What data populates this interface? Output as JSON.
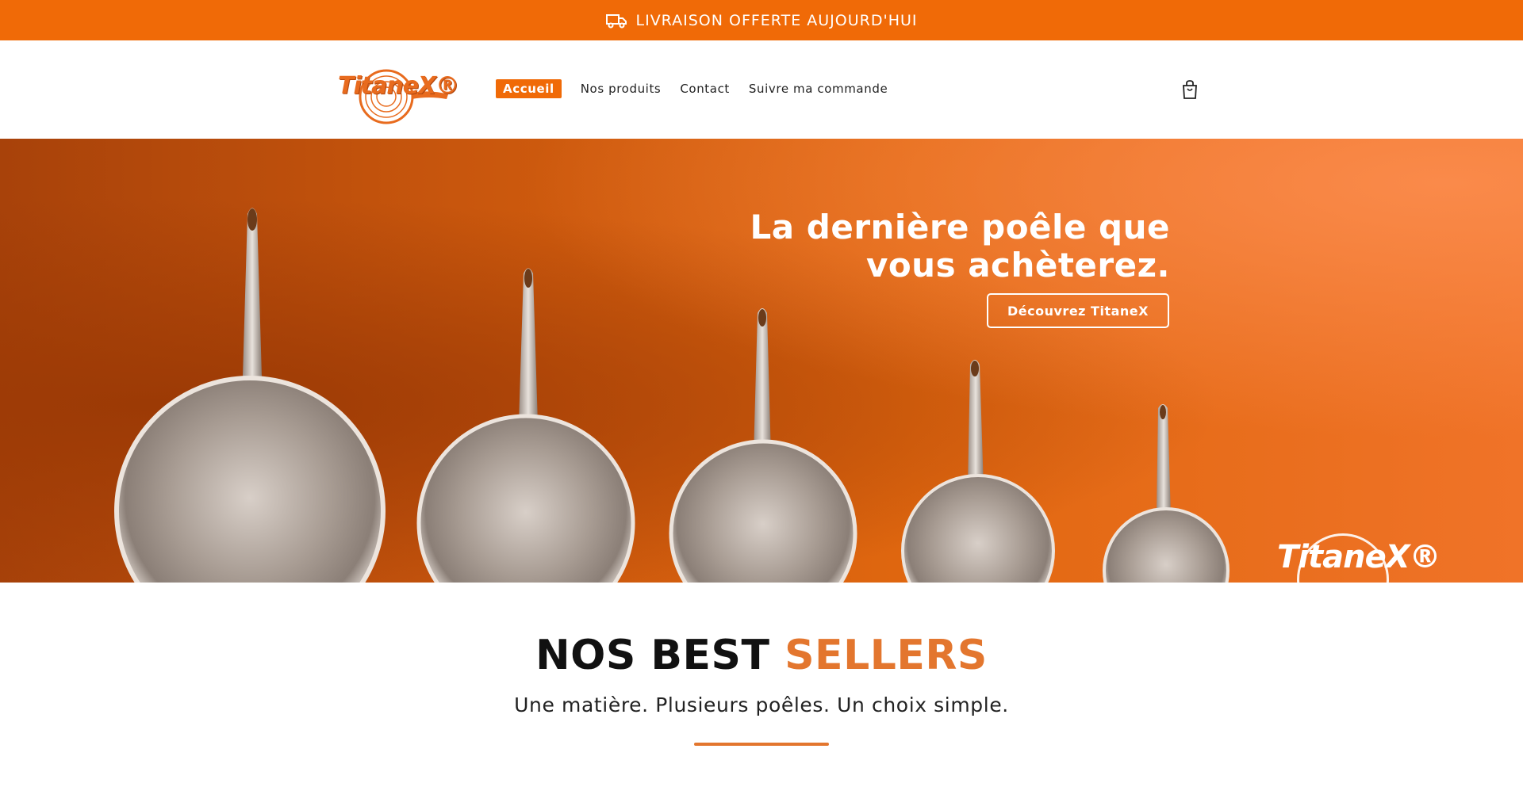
{
  "announcement": {
    "text": "LIVRAISON OFFERTE AUJOURD'HUI",
    "icon": "truck-icon"
  },
  "brand": {
    "logo_text": "TitaneX®",
    "accent": "#f06a07"
  },
  "nav": {
    "items": [
      {
        "label": "Accueil",
        "active": true
      },
      {
        "label": "Nos produits",
        "active": false
      },
      {
        "label": "Contact",
        "active": false
      },
      {
        "label": "Suivre ma commande",
        "active": false
      }
    ]
  },
  "header": {
    "cart_icon": "shopping-bag-icon"
  },
  "hero": {
    "title_line1": "La dernière poêle que",
    "title_line2": "vous achèterez.",
    "cta_label": "Découvrez TitaneX",
    "watermark": "TitaneX®"
  },
  "best_sellers": {
    "title_part1": "NOS BEST",
    "title_part2": "SELLERS",
    "subtitle": "Une matière. Plusieurs poêles. Un choix simple.",
    "accent_color": "#e3762e"
  }
}
